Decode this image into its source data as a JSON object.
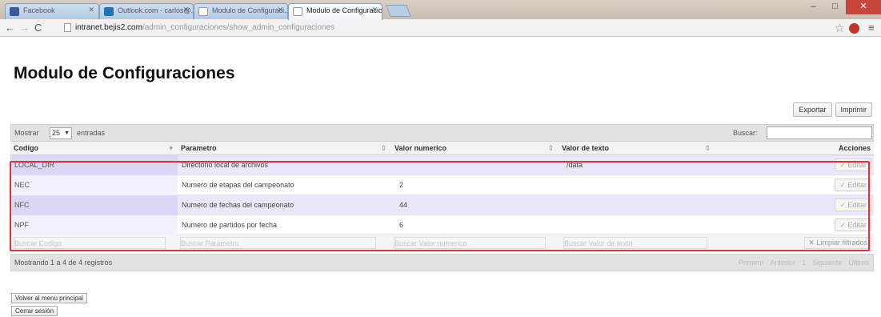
{
  "browser": {
    "tabs": [
      {
        "title": "Facebook",
        "color": "#3b5998"
      },
      {
        "title": "Outlook.com - carlos@...",
        "color": "#1e73be"
      },
      {
        "title": "Modulo de Configuraci...",
        "color": "#ffffff"
      },
      {
        "title": "Modulo de Configuracio",
        "color": "#ffffff"
      }
    ],
    "url_host": "intranet.bejis2.com",
    "url_path": "/admin_configuraciones/show_admin_configuraciones"
  },
  "page": {
    "title": "Modulo de Configuraciones",
    "export_label": "Exportar",
    "print_label": "Imprimir"
  },
  "table": {
    "length_label": "Mostrar",
    "length_value": "25",
    "length_suffix": "entradas",
    "search_label": "Buscar:",
    "columns": [
      "Codigo",
      "Parametro",
      "Valor numerico",
      "Valor de texto",
      "Acciones"
    ],
    "rows": [
      {
        "codigo": "LOCAL_DIR",
        "parametro": "Directorio local de archivos",
        "valor_numerico": "",
        "valor_texto": "/data",
        "accion": "Editar"
      },
      {
        "codigo": "NEC",
        "parametro": "Numero de etapas del campeonato",
        "valor_numerico": "2",
        "valor_texto": "",
        "accion": "Editar"
      },
      {
        "codigo": "NFC",
        "parametro": "Numero de fechas del campeonato",
        "valor_numerico": "44",
        "valor_texto": "",
        "accion": "Editar"
      },
      {
        "codigo": "NPF",
        "parametro": "Numero de partidos por fecha",
        "valor_numerico": "6",
        "valor_texto": "",
        "accion": "Editar"
      }
    ],
    "filters": {
      "codigo": "Buscar Codigo",
      "parametro": "Buscar Parametro",
      "valor_numerico": "Buscar Valor numerico",
      "valor_texto": "Buscar Valor de texto",
      "clear_label": "Limpiar filtrados"
    },
    "info": "Mostrando 1 a 4 de 4 registros",
    "pager": [
      "Primero",
      "Anterior",
      "1",
      "Siguiente",
      "Último"
    ]
  },
  "footer": {
    "back_label": "Volver al menu principal",
    "logout_label": "Cerrar sesión"
  },
  "colors": {
    "highlight": "#e0303a",
    "row_odd": "#e9e9fb"
  }
}
